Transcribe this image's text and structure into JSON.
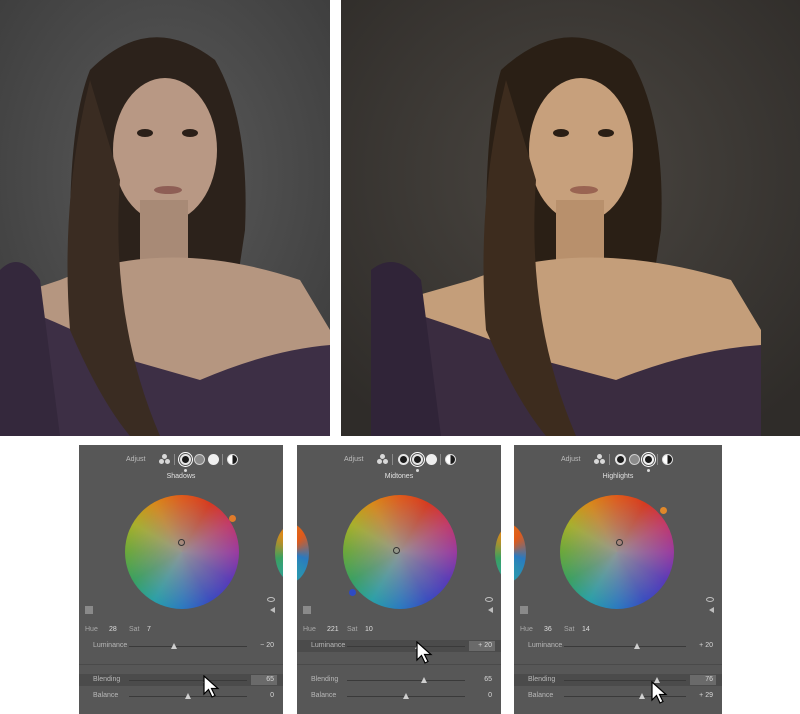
{
  "panels": [
    {
      "adjust_label": "Adjust",
      "title": "Shadows",
      "hue_label": "Hue",
      "hue_value": "28",
      "sat_label": "Sat",
      "sat_value": "7",
      "luminance_label": "Luminance",
      "luminance_value": "− 20",
      "luminance_level": 0.38,
      "blending_label": "Blending",
      "blending_value": "65",
      "blending_level": 0.65,
      "balance_label": "Balance",
      "balance_value": "0",
      "balance_level": 0.5,
      "active_slider": "blending",
      "selected_mode": "shadows"
    },
    {
      "adjust_label": "Adjust",
      "title": "Midtones",
      "hue_label": "Hue",
      "hue_value": "221",
      "sat_label": "Sat",
      "sat_value": "10",
      "luminance_label": "Luminance",
      "luminance_value": "+ 20",
      "luminance_level": 0.6,
      "blending_label": "Blending",
      "blending_value": "65",
      "blending_level": 0.65,
      "balance_label": "Balance",
      "balance_value": "0",
      "balance_level": 0.5,
      "active_slider": "luminance",
      "selected_mode": "midtones"
    },
    {
      "adjust_label": "Adjust",
      "title": "Highlights",
      "hue_label": "Hue",
      "hue_value": "36",
      "sat_label": "Sat",
      "sat_value": "14",
      "luminance_label": "Luminance",
      "luminance_value": "+ 20",
      "luminance_level": 0.6,
      "blending_label": "Blending",
      "blending_value": "76",
      "blending_level": 0.76,
      "balance_label": "Balance",
      "balance_value": "+ 29",
      "balance_level": 0.64,
      "active_slider": "blending",
      "selected_mode": "highlights"
    }
  ],
  "colors": {
    "panel_bg": "#575757",
    "photo_bg_before": "#4a4a4a",
    "photo_bg_after": "#3a3632",
    "sweater": "#3d2f45"
  }
}
